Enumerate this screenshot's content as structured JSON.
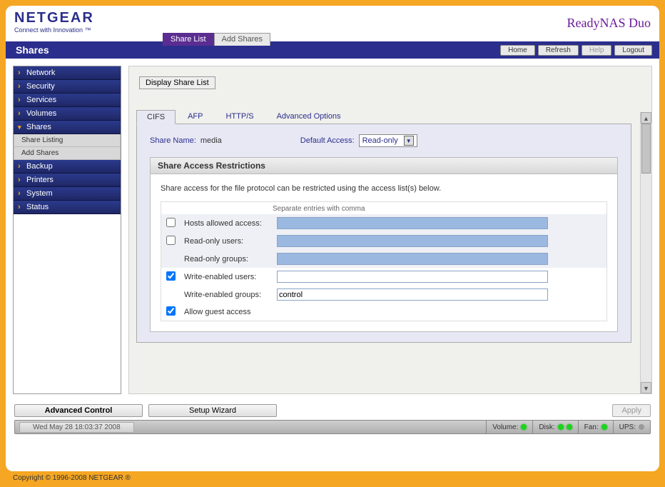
{
  "brand": {
    "name": "NETGEAR",
    "tagline": "Connect with Innovation ™",
    "product": "ReadyNAS Duo"
  },
  "top_tabs": {
    "share_list": "Share List",
    "add_shares": "Add Shares"
  },
  "title_bar": {
    "title": "Shares",
    "home": "Home",
    "refresh": "Refresh",
    "help": "Help",
    "logout": "Logout"
  },
  "sidebar": {
    "network": "Network",
    "security": "Security",
    "services": "Services",
    "volumes": "Volumes",
    "shares": "Shares",
    "share_listing": "Share Listing",
    "add_shares": "Add Shares",
    "backup": "Backup",
    "printers": "Printers",
    "system": "System",
    "status": "Status"
  },
  "main": {
    "display_btn": "Display Share List",
    "tabs": {
      "cifs": "CIFS",
      "afp": "AFP",
      "https": "HTTP/S",
      "advanced": "Advanced Options"
    },
    "share_name_label": "Share Name:",
    "share_name_value": "media",
    "default_access_label": "Default Access:",
    "default_access_value": "Read-only",
    "restrictions": {
      "header": "Share Access Restrictions",
      "intro": "Share access for the file protocol can be restricted using the access list(s) below.",
      "note": "Separate entries with comma",
      "rows": {
        "hosts_allowed": "Hosts allowed access:",
        "readonly_users": "Read-only users:",
        "readonly_groups": "Read-only groups:",
        "write_users": "Write-enabled users:",
        "write_groups": "Write-enabled groups:",
        "guest": "Allow guest access"
      },
      "values": {
        "write_groups": "control"
      },
      "checked": {
        "hosts": false,
        "readonly": false,
        "write": true,
        "guest": true
      }
    }
  },
  "bottom": {
    "advanced": "Advanced Control",
    "wizard": "Setup Wizard",
    "apply": "Apply"
  },
  "status": {
    "datetime": "Wed May 28  18:03:37 2008",
    "volume": "Volume:",
    "disk": "Disk:",
    "fan": "Fan:",
    "ups": "UPS:"
  },
  "copyright": "Copyright © 1996-2008 NETGEAR ®"
}
